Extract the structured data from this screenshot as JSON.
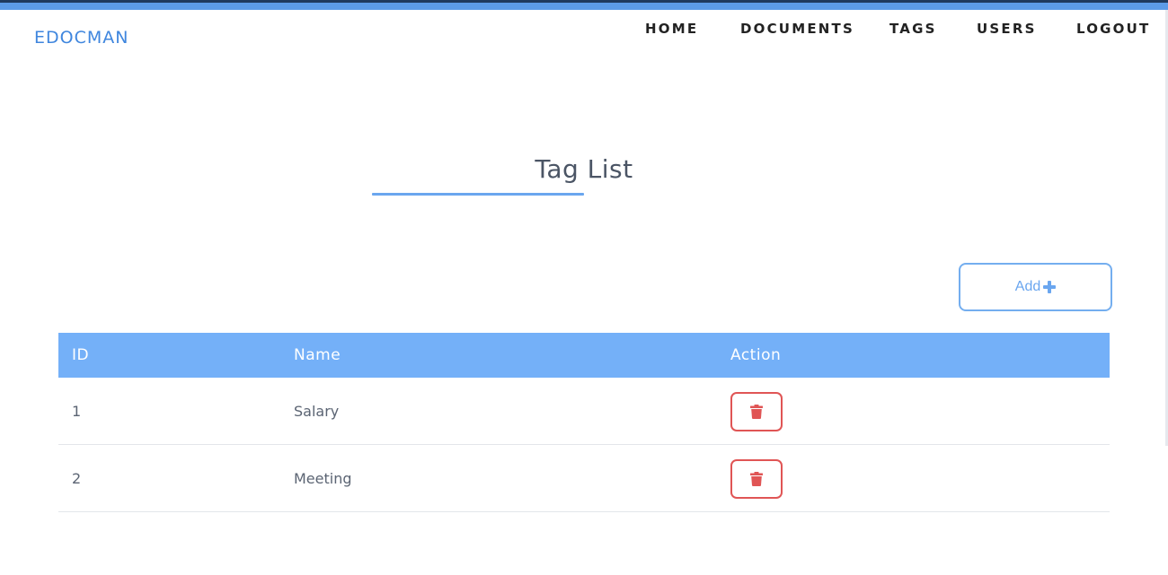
{
  "brand": "EDOCMAN",
  "nav": {
    "home": "HOME",
    "documents": "DOCUMENTS",
    "tags": "TAGS",
    "users": "USERS",
    "logout": "LOGOUT"
  },
  "page": {
    "title": "Tag List",
    "add_label": "Add"
  },
  "table": {
    "headers": {
      "id": "ID",
      "name": "Name",
      "action": "Action"
    },
    "rows": [
      {
        "id": "1",
        "name": "Salary"
      },
      {
        "id": "2",
        "name": "Meeting"
      }
    ]
  },
  "icons": {
    "add": "plus-icon",
    "delete": "trash-icon"
  },
  "colors": {
    "accent": "#74b0f8",
    "brand": "#3f86de",
    "danger": "#e05555"
  }
}
